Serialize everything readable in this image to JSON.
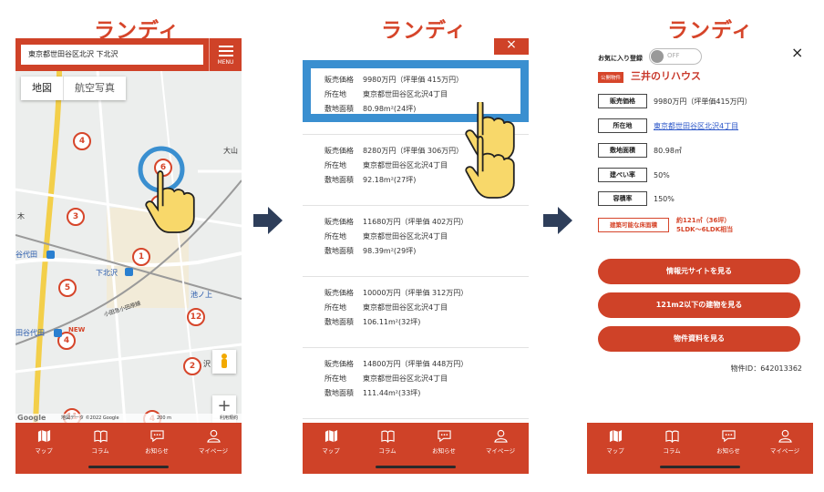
{
  "logo_text": "ランディ",
  "colors": {
    "brand": "#cf4228",
    "highlight": "#3a8fd0",
    "link": "#2a55c8"
  },
  "tabbar": [
    {
      "label": "マップ",
      "icon": "map-icon"
    },
    {
      "label": "コラム",
      "icon": "book-icon"
    },
    {
      "label": "お知らせ",
      "icon": "chat-icon"
    },
    {
      "label": "マイページ",
      "icon": "user-icon"
    }
  ],
  "screen1": {
    "search_value": "東京都世田谷区北沢 下北沢",
    "menu_label": "MENU",
    "map_toggle": {
      "map": "地図",
      "satellite": "航空写真"
    },
    "pins": [
      "4",
      "6",
      "6",
      "3",
      "1",
      "5",
      "4",
      "12",
      "2",
      "11",
      "4"
    ],
    "new_badge": "NEW",
    "labels": {
      "oyama": "大山",
      "kita": "北",
      "shimokitazawa": "下北沢",
      "higashi": "東",
      "kimoku": "木",
      "setagaya": "谷代田",
      "ikenoue": "池ノ上",
      "tanaka": "田谷代田",
      "ikebashi": "小田急小田原線",
      "sawa": "沢"
    },
    "map_footer": {
      "brand": "Google",
      "attribution": "地図データ ©2022 Google",
      "scale": "200 m",
      "terms": "利用規約"
    },
    "zoom_in": "+",
    "zoom_out": "−"
  },
  "screen2": {
    "close": "×",
    "row_labels": {
      "price": "販売価格",
      "address": "所在地",
      "area": "敷地面積"
    },
    "listings": [
      {
        "price": "9980万円（坪単価 415万円）",
        "address": "東京都世田谷区北沢4丁目",
        "area": "80.98m²(24坪)"
      },
      {
        "price": "8280万円（坪単価 306万円）",
        "address": "東京都世田谷区北沢4丁目",
        "area": "92.18m²(27坪)"
      },
      {
        "price": "11680万円（坪単価 402万円）",
        "address": "東京都世田谷区北沢4丁目",
        "area": "98.39m²(29坪)"
      },
      {
        "price": "10000万円（坪単価 312万円）",
        "address": "東京都世田谷区北沢4丁目",
        "area": "106.11m²(32坪)"
      },
      {
        "price": "14800万円（坪単価 448万円）",
        "address": "東京都世田谷区北沢4丁目",
        "area": "111.44m²(33坪)"
      }
    ]
  },
  "screen3": {
    "fav_label": "お気に入り登録",
    "fav_state": "OFF",
    "close": "×",
    "badge": "公開物件",
    "company": "三井のリハウス",
    "rows": [
      {
        "key": "販売価格",
        "value": "9980万円（坪単価415万円）"
      },
      {
        "key": "所在地",
        "value": "東京都世田谷区北沢4丁目"
      },
      {
        "key": "敷地面積",
        "value": "80.98㎡"
      },
      {
        "key": "建ぺい率",
        "value": "50%"
      },
      {
        "key": "容積率",
        "value": "150%"
      }
    ],
    "floor_key": "建築可能な床面積",
    "floor_value_1": "約121㎡（36坪）",
    "floor_value_2": "5LDK〜6LDK相当",
    "buttons": [
      "情報元サイトを見る",
      "121m2以下の建物を見る",
      "物件資料を見る"
    ],
    "property_id": "物件ID：642013362"
  }
}
